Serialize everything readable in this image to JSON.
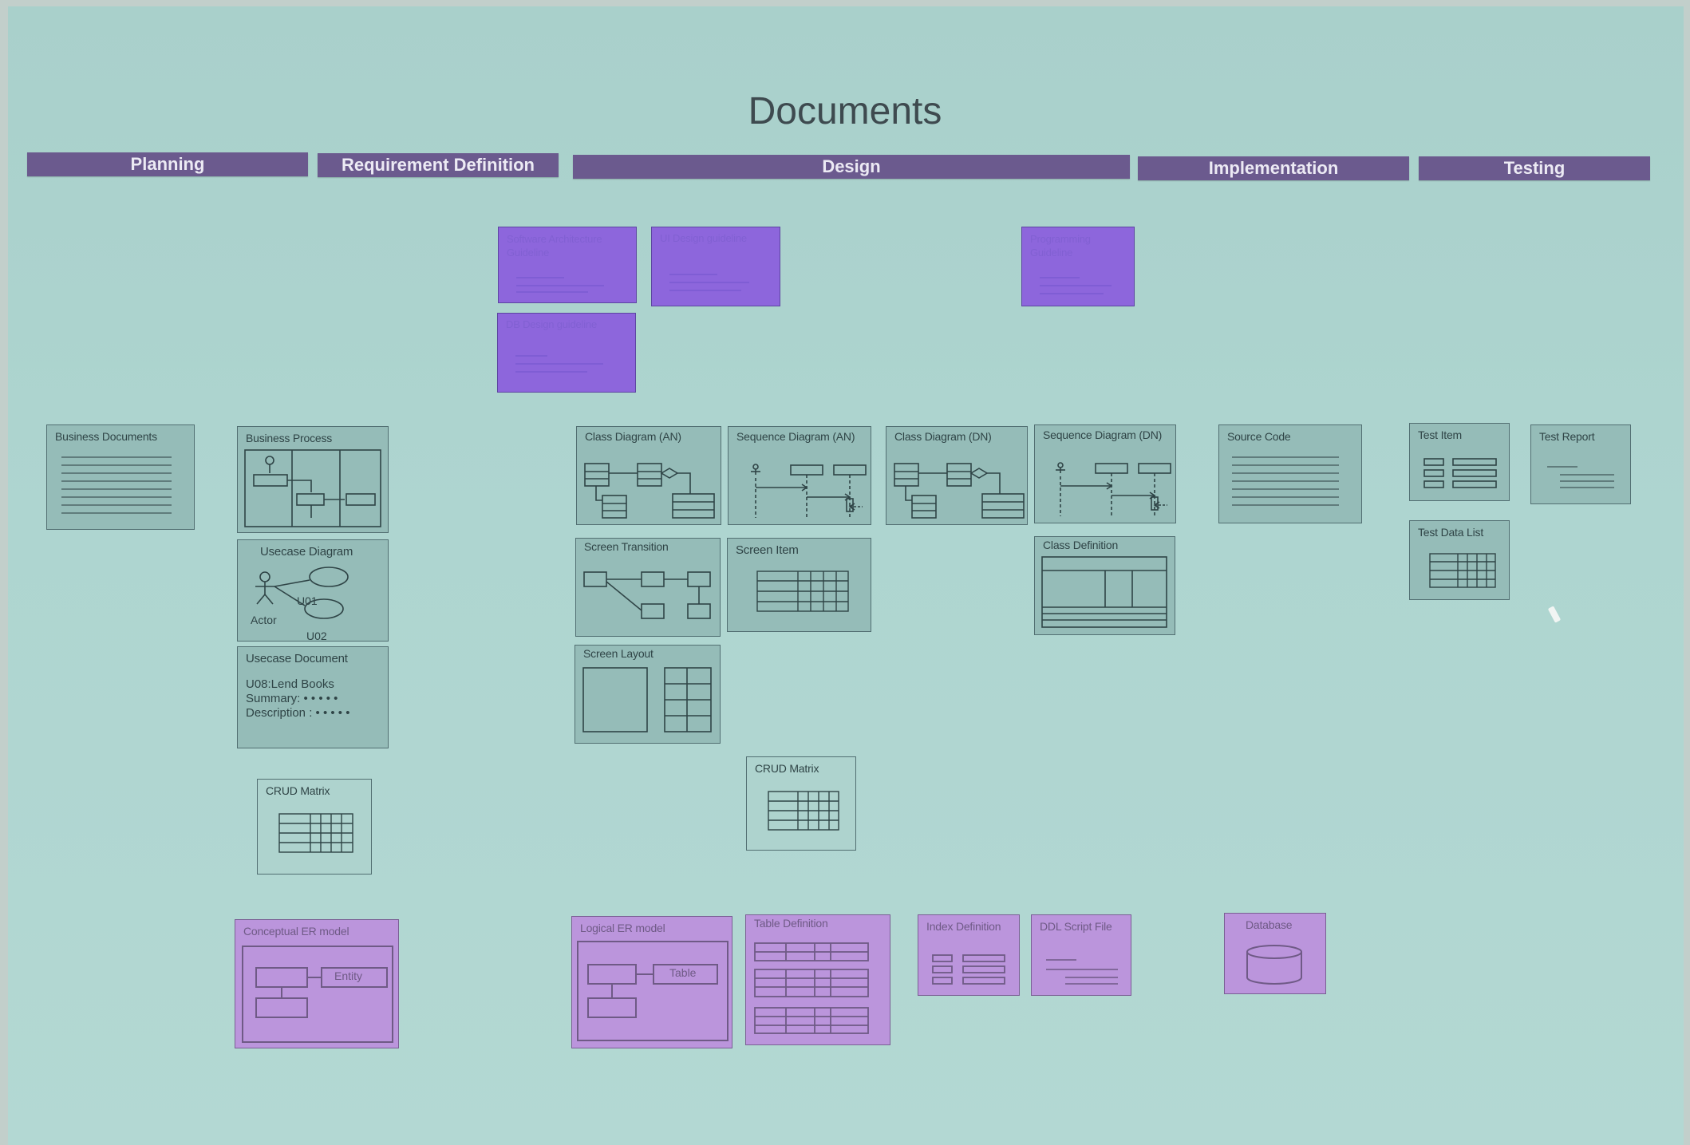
{
  "title": "Documents",
  "phases": [
    {
      "label": "Planning"
    },
    {
      "label": "Requirement Definition"
    },
    {
      "label": "Design"
    },
    {
      "label": "Implementation"
    },
    {
      "label": "Testing"
    }
  ],
  "docs": {
    "business_documents": "Business Documents",
    "business_process": "Business Process",
    "usecase_diagram": "Usecase Diagram",
    "uc_u01": "U01",
    "uc_actor": "Actor",
    "uc_u02": "U02",
    "usecase_document": "Usecase Document",
    "ucd_line1": "U08:Lend Books",
    "ucd_line2": "Summary: • • • • •",
    "ucd_line3": "Description : • • • • •",
    "crud_matrix_req": "CRUD Matrix",
    "conceptual_er": "Conceptual ER model",
    "entity": "Entity",
    "class_diagram_an": "Class Diagram (AN)",
    "sequence_diagram_an": "Sequence Diagram (AN)",
    "class_diagram_dn": "Class Diagram (DN)",
    "sequence_diagram_dn": "Sequence Diagram (DN)",
    "screen_transition": "Screen Transition",
    "screen_item": "Screen Item",
    "class_definition": "Class Definition",
    "screen_layout": "Screen Layout",
    "crud_matrix_design": "CRUD Matrix",
    "logical_er": "Logical ER model",
    "table": "Table",
    "table_definition": "Table Definition",
    "index_definition": "Index Definition",
    "ddl_script": "DDL Script File",
    "source_code": "Source Code",
    "database": "Database",
    "test_item": "Test Item",
    "test_report": "Test Report",
    "test_data_list": "Test Data List"
  }
}
